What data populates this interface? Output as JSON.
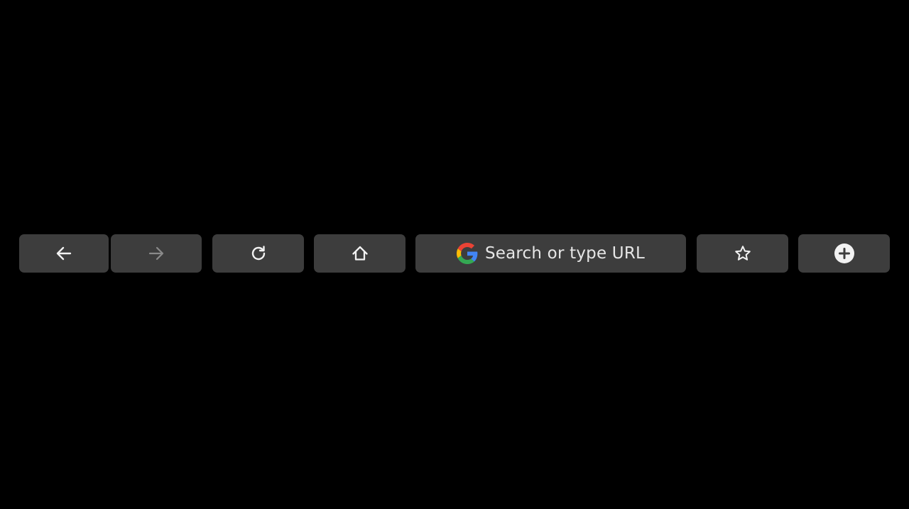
{
  "touchbar": {
    "back": {
      "icon": "arrow-left-icon",
      "enabled": true
    },
    "forward": {
      "icon": "arrow-right-icon",
      "enabled": false
    },
    "reload": {
      "icon": "reload-icon"
    },
    "home": {
      "icon": "home-icon"
    },
    "search": {
      "icon": "google-g-icon",
      "label": "Search or type URL"
    },
    "bookmark": {
      "icon": "star-icon"
    },
    "new_tab": {
      "icon": "plus-circle-icon"
    }
  },
  "colors": {
    "background": "#000000",
    "key": "#3d3d3d",
    "icon": "#f2f2f2",
    "icon_disabled": "#8a8a8a",
    "google_blue": "#4285F4",
    "google_red": "#EA4335",
    "google_yellow": "#FBBC05",
    "google_green": "#34A853"
  }
}
